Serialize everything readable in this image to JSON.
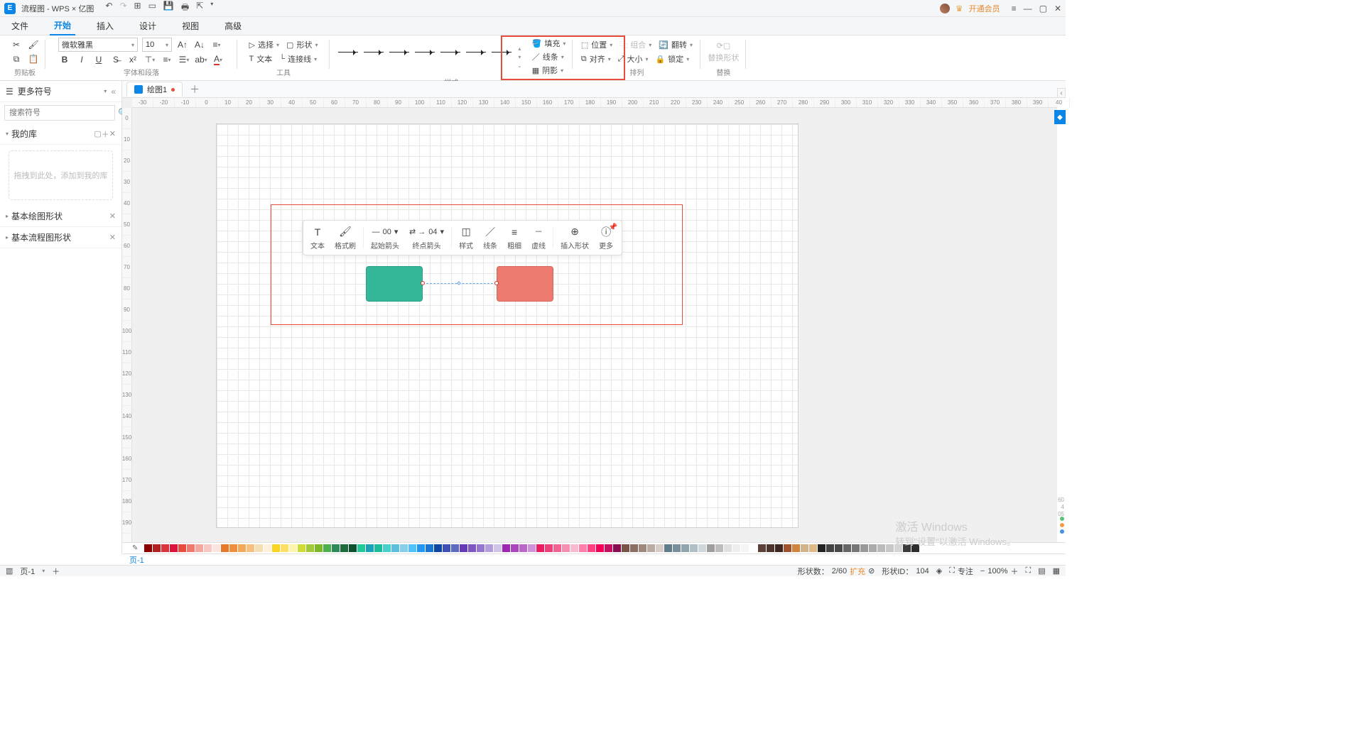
{
  "titlebar": {
    "app_title": "流程图 - WPS × 亿图",
    "member_label": "开通会员"
  },
  "menus": {
    "file": "文件",
    "start": "开始",
    "insert": "插入",
    "design": "设计",
    "view": "视图",
    "advanced": "高级"
  },
  "ribbon": {
    "clipboard_label": "剪贴板",
    "font_group_label": "字体和段落",
    "tools_label": "工具",
    "styles_label": "样式",
    "arrange_label": "排列",
    "replace_label": "替换",
    "font_name": "微软雅黑",
    "font_size": "10",
    "select": "选择",
    "shape": "形状",
    "text": "文本",
    "connector": "连接线",
    "fill": "填充",
    "line": "线条",
    "shadow": "阴影",
    "position": "位置",
    "align": "对齐",
    "group": "组合",
    "size": "大小",
    "rotate": "翻转",
    "lock": "锁定",
    "replace_shape": "替换形状"
  },
  "left_panel": {
    "more_symbols": "更多符号",
    "search_placeholder": "搜索符号",
    "my_lib": "我的库",
    "drop_hint": "拖拽到此处，添加到我的库",
    "basic_shapes": "基本绘图形状",
    "flowchart_shapes": "基本流程图形状"
  },
  "doc": {
    "tab_name": "绘图1"
  },
  "float_toolbar": {
    "text": "文本",
    "format_painter": "格式刷",
    "start_arrow": "起始箭头",
    "start_arrow_val": "00",
    "end_arrow": "终点箭头",
    "end_arrow_val": "04",
    "style": "样式",
    "line": "线条",
    "weight": "粗细",
    "dash": "虚线",
    "insert_shape": "插入形状",
    "more": "更多"
  },
  "hruler": [
    "-30",
    "-20",
    "-10",
    "0",
    "10",
    "20",
    "30",
    "40",
    "50",
    "60",
    "70",
    "80",
    "90",
    "100",
    "110",
    "120",
    "130",
    "140",
    "150",
    "160",
    "170",
    "180",
    "190",
    "200",
    "210",
    "220",
    "230",
    "240",
    "250",
    "260",
    "270",
    "280",
    "290",
    "300",
    "310",
    "320",
    "330",
    "340",
    "350",
    "360",
    "370",
    "380",
    "390",
    "40"
  ],
  "vruler": [
    "0",
    "10",
    "20",
    "30",
    "40",
    "50",
    "60",
    "70",
    "80",
    "90",
    "100",
    "110",
    "120",
    "130",
    "140",
    "150",
    "160",
    "170",
    "180",
    "190"
  ],
  "colors": [
    "#8b0000",
    "#b22222",
    "#d9363e",
    "#dc143c",
    "#e74c3c",
    "#f17a6e",
    "#f5a8a0",
    "#f8c8c3",
    "#fce4e1",
    "#e7792b",
    "#ee8f3d",
    "#f3a85a",
    "#f6c07f",
    "#f5deb3",
    "#fff0db",
    "#f9d423",
    "#ffe066",
    "#fff3b0",
    "#cddc39",
    "#a2c93a",
    "#7db828",
    "#4caf50",
    "#2e8b57",
    "#1f6b3b",
    "#0e5030",
    "#20c997",
    "#17a2b8",
    "#1abc9c",
    "#48d1cc",
    "#5bc0de",
    "#87ceeb",
    "#4fc3f7",
    "#2196f3",
    "#1976d2",
    "#0d47a1",
    "#3f51b5",
    "#5c6bc0",
    "#673ab7",
    "#7e57c2",
    "#9575cd",
    "#b39ddb",
    "#d1c4e9",
    "#9c27b0",
    "#ab47bc",
    "#ba68c8",
    "#ce93d8",
    "#e91e63",
    "#ec407a",
    "#f06292",
    "#f48fb1",
    "#f8bbd0",
    "#ff80ab",
    "#ff4081",
    "#f50057",
    "#c51162",
    "#880e4f",
    "#795548",
    "#8d6e63",
    "#a1887f",
    "#bcaaa4",
    "#d7ccc8",
    "#607d8b",
    "#78909c",
    "#90a4ae",
    "#b0bec5",
    "#cfd8dc",
    "#9e9e9e",
    "#bdbdbd",
    "#e0e0e0",
    "#eeeeee",
    "#f5f5f5",
    "#ffffff",
    "#5d4037",
    "#4e342e",
    "#3e2723",
    "#a0522d",
    "#cd853f",
    "#d2b48c",
    "#deb887",
    "#222222",
    "#444444",
    "#4a4a4a",
    "#666666",
    "#777777",
    "#999999",
    "#aaaaaa",
    "#bbbbbb",
    "#c7c7c7",
    "#d4d4d4",
    "#3a3a3a",
    "#2d2d2d"
  ],
  "pagebar": {
    "page_tab": "页-1"
  },
  "statusbar": {
    "page": "页-1",
    "shape_count_label": "形状数：",
    "shape_count": "2/60",
    "expand": "扩充",
    "shape_id_label": "形状ID：",
    "shape_id": "104",
    "focus": "专注",
    "zoom": "100%"
  },
  "watermark": {
    "line1": "激活 Windows",
    "line2": "转到\"设置\"以激活 Windows。"
  }
}
